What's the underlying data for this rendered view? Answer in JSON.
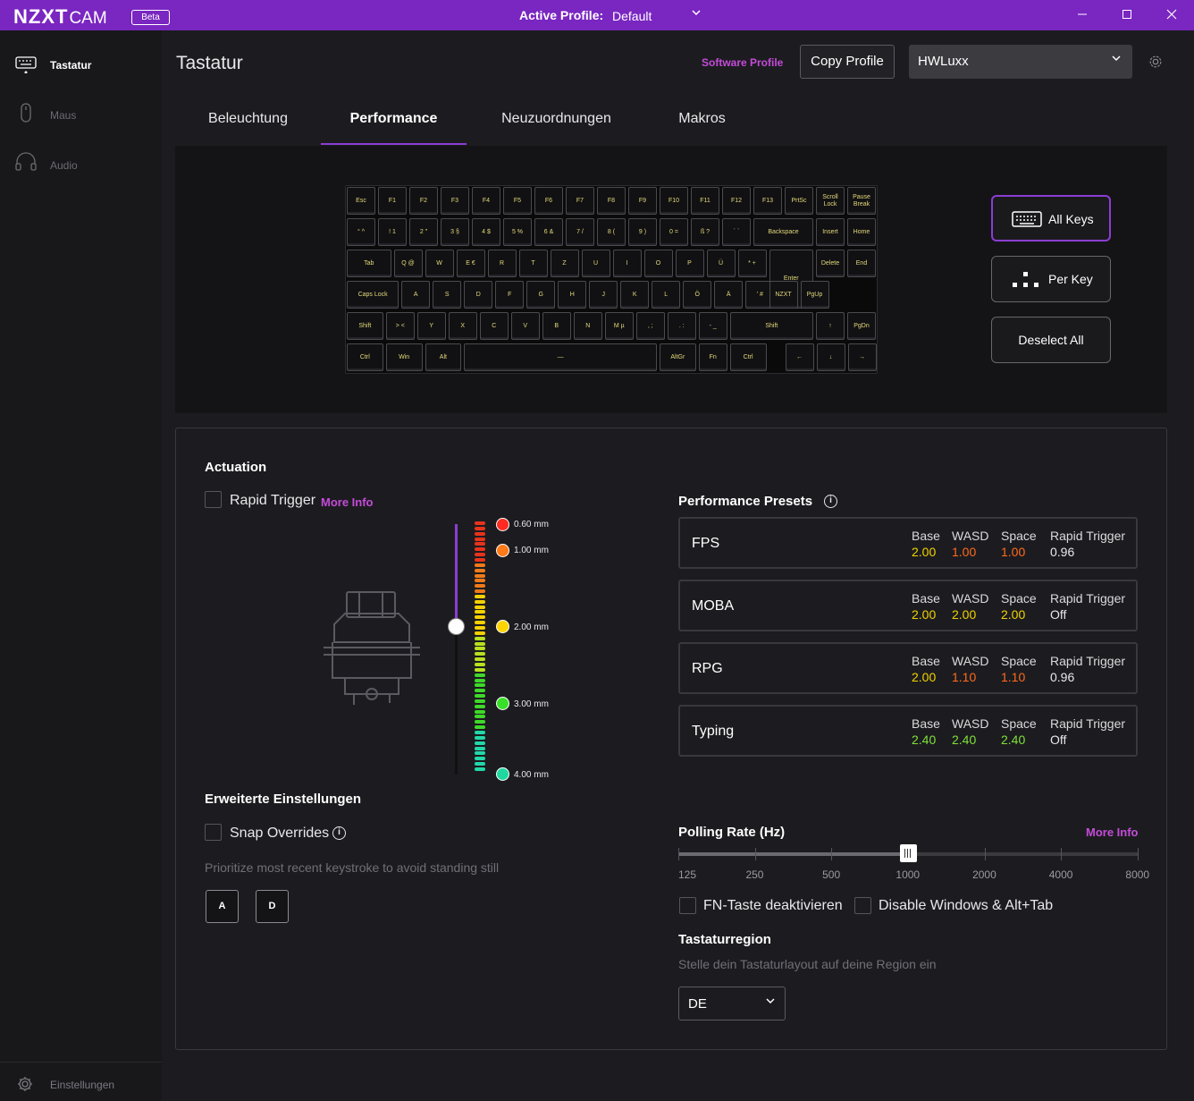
{
  "titlebar": {
    "logo": "NZXT",
    "logo_cam": "CAM",
    "beta": "Beta",
    "active_profile_label": "Active Profile:",
    "active_profile_value": "Default"
  },
  "sidebar": {
    "items": [
      {
        "label": "Tastatur",
        "icon": "keyboard-icon"
      },
      {
        "label": "Maus",
        "icon": "mouse-icon"
      },
      {
        "label": "Audio",
        "icon": "headset-icon"
      }
    ],
    "settings_label": "Einstellungen"
  },
  "header": {
    "title": "Tastatur",
    "software_profile": "Software Profile",
    "copy_profile": "Copy Profile",
    "device_select": "HWLuxx"
  },
  "tabs": [
    "Beleuchtung",
    "Performance",
    "Neuzuordnungen",
    "Makros"
  ],
  "keyboard": {
    "rows": [
      [
        "Esc",
        "F1",
        "F2",
        "F3",
        "F4",
        "F5",
        "F6",
        "F7",
        "F8",
        "F9",
        "F10",
        "F11",
        "F12",
        "F13",
        "PrtSc",
        "Scroll Lock",
        "Pause Break"
      ],
      [
        "° ^",
        "! 1",
        "2 \"",
        "3 §",
        "4 $",
        "5 %",
        "6 &",
        "7 /",
        "8 (",
        "9 )",
        "0 =",
        "ß ?",
        "´ `",
        "Backspace",
        "Insert",
        "Home"
      ],
      [
        "Tab",
        "Q @",
        "W",
        "E €",
        "R",
        "T",
        "Z",
        "U",
        "I",
        "O",
        "P",
        "Ü",
        "* +",
        "Enter",
        "Delete",
        "End"
      ],
      [
        "Caps Lock",
        "A",
        "S",
        "D",
        "F",
        "G",
        "H",
        "J",
        "K",
        "L",
        "Ö",
        "Ä",
        "' #",
        "NZXT",
        "PgUp"
      ],
      [
        "Shift",
        "> <",
        "Y",
        "X",
        "C",
        "V",
        "B",
        "N",
        "M µ",
        ", ;",
        ". :",
        "- _",
        "Shift",
        "↑",
        "PgDn"
      ],
      [
        "Ctrl",
        "Win",
        "Alt",
        "—",
        "AltGr",
        "Fn",
        "Ctrl",
        "←",
        "↓",
        "→"
      ]
    ]
  },
  "selection": {
    "all_keys": "All Keys",
    "per_key": "Per Key",
    "deselect_all": "Deselect All"
  },
  "actuation": {
    "heading": "Actuation",
    "rapid_trigger": "Rapid Trigger",
    "more_info": "More Info",
    "markers": [
      "0.60 mm",
      "1.00 mm",
      "2.00 mm",
      "3.00 mm",
      "4.00 mm"
    ],
    "current_mm": 2.0
  },
  "presets": {
    "heading": "Performance Presets",
    "columns": [
      "Base",
      "WASD",
      "Space",
      "Rapid Trigger"
    ],
    "items": [
      {
        "name": "FPS",
        "base": "2.00",
        "wasd": "1.00",
        "space": "1.00",
        "rapid": "0.96"
      },
      {
        "name": "MOBA",
        "base": "2.00",
        "wasd": "2.00",
        "space": "2.00",
        "rapid": "Off"
      },
      {
        "name": "RPG",
        "base": "2.00",
        "wasd": "1.10",
        "space": "1.10",
        "rapid": "0.96"
      },
      {
        "name": "Typing",
        "base": "2.40",
        "wasd": "2.40",
        "space": "2.40",
        "rapid": "Off"
      }
    ],
    "colors": {
      "2.00": "#f2d200",
      "1.00": "#ff6a1a",
      "1.10": "#ff6a1a",
      "2.40": "#7ee03a",
      "text": "#e8e8ea"
    }
  },
  "advanced": {
    "heading": "Erweiterte Einstellungen",
    "snap_overrides": "Snap Overrides",
    "snap_hint": "Prioritize most recent keystroke to avoid standing still",
    "keys": [
      "A",
      "D"
    ]
  },
  "polling": {
    "heading": "Polling Rate (Hz)",
    "more_info": "More Info",
    "options": [
      "125",
      "250",
      "500",
      "1000",
      "2000",
      "4000",
      "8000"
    ],
    "selected": "1000"
  },
  "options": {
    "fn_disable": "FN-Taste deaktivieren",
    "win_disable": "Disable Windows & Alt+Tab"
  },
  "region": {
    "heading": "Tastaturregion",
    "hint": "Stelle dein Tastaturlayout auf deine Region ein",
    "value": "DE"
  }
}
